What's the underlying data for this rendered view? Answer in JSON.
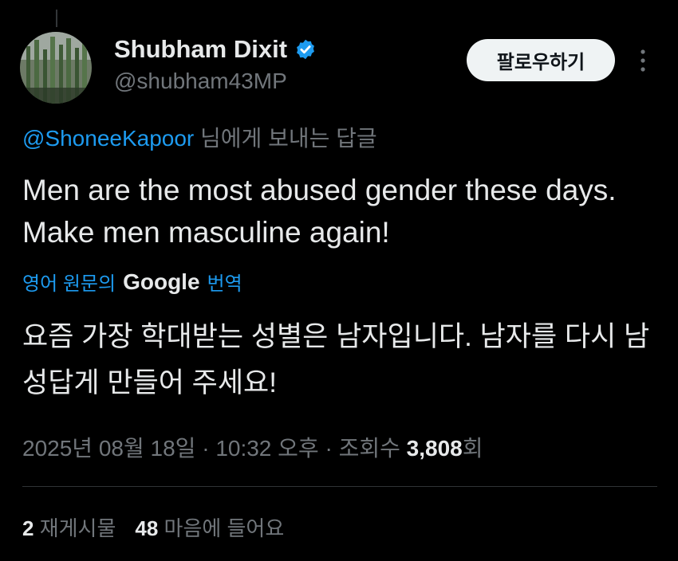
{
  "author": {
    "display_name": "Shubham Dixit",
    "handle": "@shubham43MP",
    "verified_icon": "verified-badge-icon",
    "avatar_icon": "cactus-avatar"
  },
  "actions": {
    "follow_label": "팔로우하기",
    "more_icon": "more-vertical-icon"
  },
  "reply": {
    "mention": "@ShoneeKapoor",
    "suffix": " 님에게 보내는 답글"
  },
  "tweet": {
    "text": "Men are the most abused gender these days. Make men masculine again!"
  },
  "translation": {
    "prefix": "영어 원문의",
    "provider": "Google",
    "suffix": "번역",
    "text": "요즘 가장 학대받는 성별은 남자입니다. 남자를 다시 남성답게 만들어 주세요!"
  },
  "meta": {
    "date": "2025년 08월 18일",
    "separator": " · ",
    "time": "10:32 오후",
    "views_label": "조회수 ",
    "views_count": "3,808",
    "views_unit": "회"
  },
  "stats": {
    "reposts_count": "2",
    "reposts_label": " 재게시물",
    "likes_count": "48",
    "likes_label": " 마음에 들어요"
  },
  "colors": {
    "background": "#000000",
    "text_primary": "#e7e9ea",
    "text_secondary": "#71767b",
    "accent": "#1d9bf0",
    "divider": "#2f3336",
    "button_bg": "#eff3f4"
  }
}
